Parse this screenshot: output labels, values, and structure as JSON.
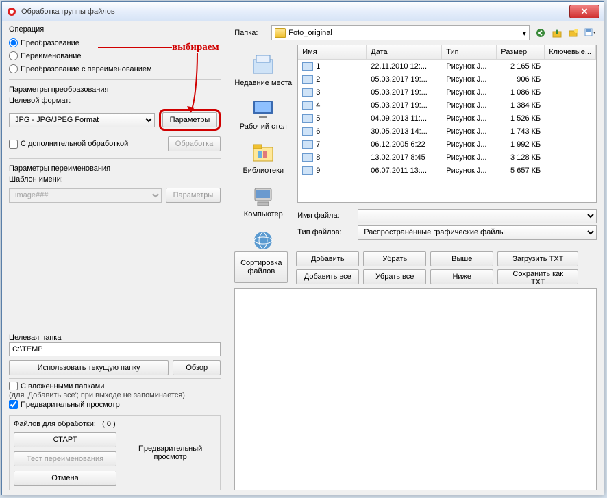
{
  "window": {
    "title": "Обработка группы файлов"
  },
  "annotation": {
    "text": "выбираем"
  },
  "operation": {
    "label": "Операция",
    "opt_transform": "Преобразование",
    "opt_rename": "Переименование",
    "opt_both": "Преобразование с переименованием"
  },
  "transform": {
    "label": "Параметры преобразования",
    "target_format_label": "Целевой формат:",
    "target_format_value": "JPG - JPG/JPEG Format",
    "params_btn": "Параметры",
    "extra_processing": "С дополнительной обработкой",
    "processing_btn": "Обработка"
  },
  "rename": {
    "label": "Параметры переименования",
    "template_label": "Шаблон имени:",
    "template_value": "image###",
    "params_btn": "Параметры"
  },
  "target_folder": {
    "label": "Целевая папка",
    "value": "C:\\TEMP",
    "use_current_btn": "Использовать текущую папку",
    "browse_btn": "Обзор"
  },
  "options": {
    "subfolders_label": "С вложенными папками",
    "subfolders_note": "(для 'Добавить все'; при выходе не запоминается)",
    "preview_label": "Предварительный просмотр"
  },
  "run": {
    "files_for": "Файлов для обработки:",
    "count": "( 0 )",
    "start": "СТАРТ",
    "test_rename": "Тест переименования",
    "cancel": "Отмена",
    "preview_caption": "Предварительный просмотр"
  },
  "browser": {
    "folder_label": "Папка:",
    "folder_value": "Foto_original",
    "nav": {
      "recent": "Недавние места",
      "desktop": "Рабочий стол",
      "libraries": "Библиотеки",
      "computer": "Компьютер",
      "network": ""
    },
    "columns": {
      "name": "Имя",
      "date": "Дата",
      "type": "Тип",
      "size": "Размер",
      "keywords": "Ключевые..."
    },
    "files": [
      {
        "name": "1",
        "date": "22.11.2010 12:...",
        "type": "Рисунок J...",
        "size": "2 165 КБ"
      },
      {
        "name": "2",
        "date": "05.03.2017 19:...",
        "type": "Рисунок J...",
        "size": "906 КБ"
      },
      {
        "name": "3",
        "date": "05.03.2017 19:...",
        "type": "Рисунок J...",
        "size": "1 086 КБ"
      },
      {
        "name": "4",
        "date": "05.03.2017 19:...",
        "type": "Рисунок J...",
        "size": "1 384 КБ"
      },
      {
        "name": "5",
        "date": "04.09.2013 11:...",
        "type": "Рисунок J...",
        "size": "1 526 КБ"
      },
      {
        "name": "6",
        "date": "30.05.2013 14:...",
        "type": "Рисунок J...",
        "size": "1 743 КБ"
      },
      {
        "name": "7",
        "date": "06.12.2005 6:22",
        "type": "Рисунок J...",
        "size": "1 992 КБ"
      },
      {
        "name": "8",
        "date": "13.02.2017 8:45",
        "type": "Рисунок J...",
        "size": "3 128 КБ"
      },
      {
        "name": "9",
        "date": "06.07.2011 13:...",
        "type": "Рисунок J...",
        "size": "5 657 КБ"
      }
    ],
    "filename_label": "Имя файла:",
    "filename_value": "",
    "filetype_label": "Тип файлов:",
    "filetype_value": "Распространённые графические файлы"
  },
  "buttons": {
    "sort": "Сортировка файлов",
    "add": "Добавить",
    "remove": "Убрать",
    "up": "Выше",
    "load_txt": "Загрузить TXT",
    "add_all": "Добавить все",
    "remove_all": "Убрать все",
    "down": "Ниже",
    "save_txt": "Сохранить как TXT"
  }
}
